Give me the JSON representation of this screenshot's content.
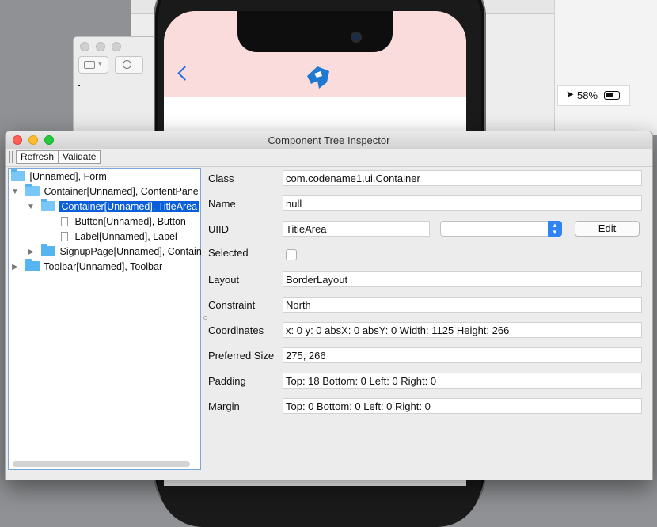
{
  "background": {
    "status_battery": "58%"
  },
  "inspector": {
    "title": "Component Tree Inspector",
    "toolbar": {
      "refresh_label": "Refresh",
      "validate_label": "Validate"
    },
    "tree": [
      {
        "label": "[Unnamed], Form",
        "expanded": true
      },
      {
        "label": "Container[Unnamed], ContentPane",
        "expanded": true
      },
      {
        "label": "Container[Unnamed], TitleArea",
        "expanded": true,
        "selected": true
      },
      {
        "label": "Button[Unnamed], Button"
      },
      {
        "label": "Label[Unnamed], Label"
      },
      {
        "label": "SignupPage[Unnamed], Contain",
        "expanded": false
      },
      {
        "label": "Toolbar[Unnamed], Toolbar",
        "expanded": false
      }
    ],
    "properties": {
      "class_label": "Class",
      "class_value": "com.codename1.ui.Container",
      "name_label": "Name",
      "name_value": "null",
      "uiid_label": "UIID",
      "uiid_value": "TitleArea",
      "uiid_combo_value": "",
      "edit_label": "Edit",
      "selected_label": "Selected",
      "selected_checked": false,
      "layout_label": "Layout",
      "layout_value": "BorderLayout",
      "constraint_label": "Constraint",
      "constraint_value": "North",
      "coordinates_label": "Coordinates",
      "coordinates_value": "x: 0 y: 0 absX: 0 absY: 0 Width: 1125 Height: 266",
      "preferred_size_label": "Preferred Size",
      "preferred_size_value": "275, 266",
      "padding_label": "Padding",
      "padding_value": "Top: 18 Bottom: 0 Left: 0 Right: 0",
      "margin_label": "Margin",
      "margin_value": "Top: 0 Bottom: 0 Left: 0 Right: 0"
    }
  },
  "colors": {
    "selection": "#0a5fd8",
    "title_area": "#fadcdc",
    "folder": "#56b4f0",
    "accent": "#2f83f3"
  }
}
